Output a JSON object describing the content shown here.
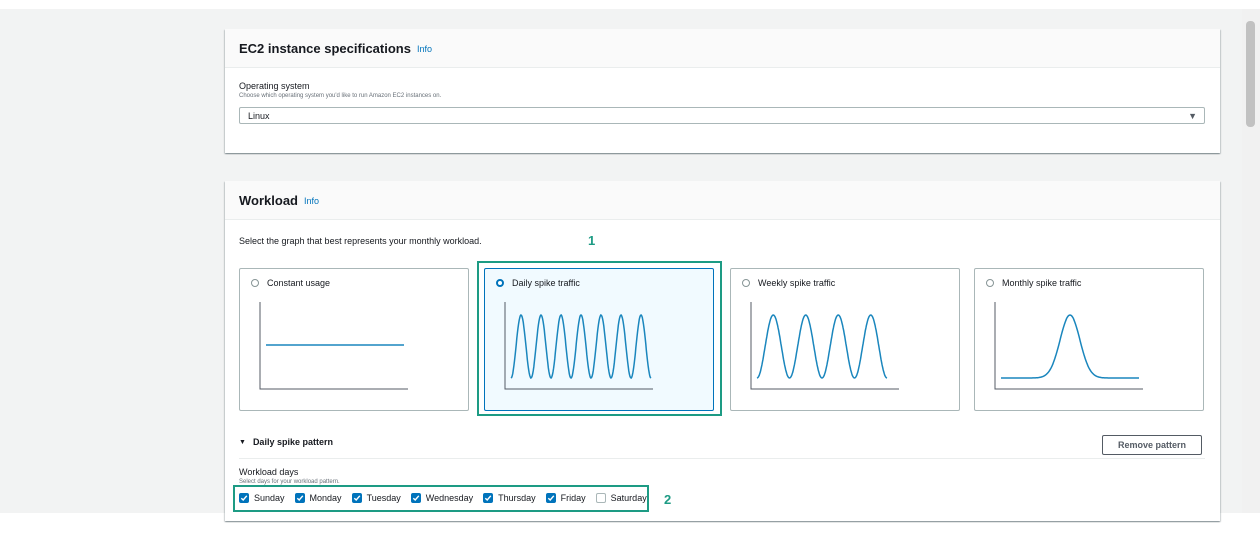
{
  "ec2_panel": {
    "title": "EC2 instance specifications",
    "info": "Info",
    "os_label": "Operating system",
    "os_description": "Choose which operating system you'd like to run Amazon EC2 instances on.",
    "os_value": "Linux"
  },
  "workload_panel": {
    "title": "Workload",
    "info": "Info",
    "intro": "Select the graph that best represents your monthly workload.",
    "options": [
      {
        "label": "Constant usage",
        "selected": false,
        "graph": "constant"
      },
      {
        "label": "Daily spike traffic",
        "selected": true,
        "graph": "daily"
      },
      {
        "label": "Weekly spike traffic",
        "selected": false,
        "graph": "weekly"
      },
      {
        "label": "Monthly spike traffic",
        "selected": false,
        "graph": "monthly"
      }
    ],
    "pattern_section": "Daily spike pattern",
    "remove_button": "Remove pattern",
    "workload_days_label": "Workload days",
    "workload_days_desc": "Select days for your workload pattern.",
    "days": [
      {
        "label": "Sunday",
        "checked": true
      },
      {
        "label": "Monday",
        "checked": true
      },
      {
        "label": "Tuesday",
        "checked": true
      },
      {
        "label": "Wednesday",
        "checked": true
      },
      {
        "label": "Thursday",
        "checked": true
      },
      {
        "label": "Friday",
        "checked": true
      },
      {
        "label": "Saturday",
        "checked": false
      }
    ]
  },
  "annotations": {
    "step1": "1",
    "step2": "2"
  },
  "colors": {
    "accent": "#0073bb",
    "graph_line": "#1a86bd",
    "highlight": "#1d9b84"
  }
}
